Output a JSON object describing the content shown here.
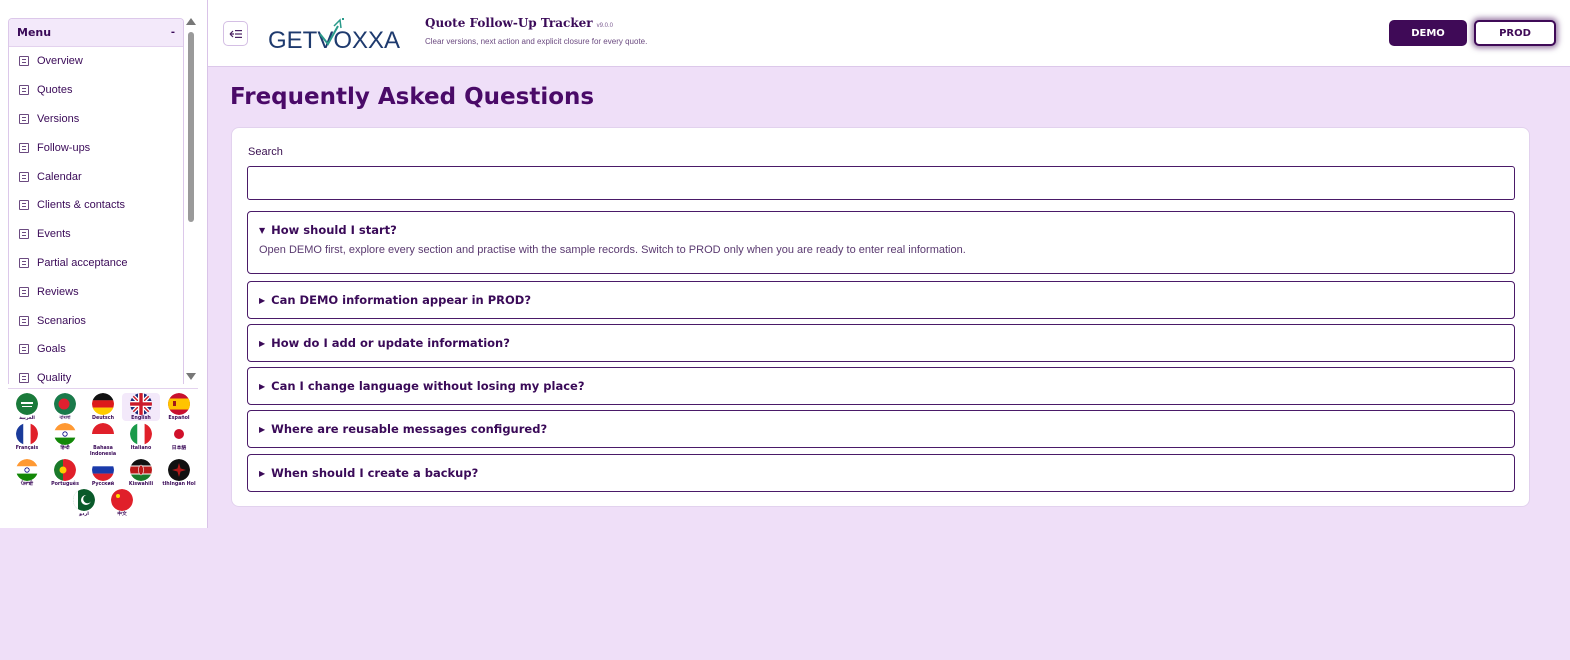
{
  "sidebar": {
    "menu_title": "Menu",
    "collapse_glyph": "-",
    "items": [
      {
        "label": "Overview"
      },
      {
        "label": "Quotes"
      },
      {
        "label": "Versions"
      },
      {
        "label": "Follow-ups"
      },
      {
        "label": "Calendar"
      },
      {
        "label": "Clients & contacts"
      },
      {
        "label": "Events"
      },
      {
        "label": "Partial acceptance"
      },
      {
        "label": "Reviews"
      },
      {
        "label": "Scenarios"
      },
      {
        "label": "Goals"
      },
      {
        "label": "Quality"
      }
    ],
    "languages": [
      {
        "label": "العربية",
        "flag": "saudi-arabia"
      },
      {
        "label": "বাংলা",
        "flag": "bangladesh"
      },
      {
        "label": "Deutsch",
        "flag": "germany"
      },
      {
        "label": "English",
        "flag": "uk",
        "active": true
      },
      {
        "label": "Español",
        "flag": "spain"
      },
      {
        "label": "Français",
        "flag": "france"
      },
      {
        "label": "हिन्दी",
        "flag": "india"
      },
      {
        "label": "Bahasa Indonesia",
        "flag": "indonesia"
      },
      {
        "label": "Italiano",
        "flag": "italy"
      },
      {
        "label": "日本語",
        "flag": "japan"
      },
      {
        "label": "ਪੰਜਾਬੀ",
        "flag": "india"
      },
      {
        "label": "Português",
        "flag": "portugal"
      },
      {
        "label": "Русский",
        "flag": "russia"
      },
      {
        "label": "Kiswahili",
        "flag": "kenya"
      },
      {
        "label": "tlhIngan Hol",
        "flag": "klingon"
      },
      {
        "label": "اردو",
        "flag": "pakistan"
      },
      {
        "label": "中文",
        "flag": "china"
      }
    ]
  },
  "header": {
    "toggle_icon": "sidebar-collapse-icon",
    "logo_text": "GETVOXXA",
    "title": "Quote Follow-Up Tracker",
    "version": "v9.0.0",
    "subtitle": "Clear versions, next action and explicit closure for every quote.",
    "demo_label": "DEMO",
    "prod_label": "PROD",
    "active_env": "PROD"
  },
  "main": {
    "page_title": "Frequently Asked Questions",
    "search_label": "Search",
    "search_value": "",
    "faqs": [
      {
        "question": "How should I start?",
        "open": true,
        "answer": "Open DEMO first, explore every section and practise with the sample records. Switch to PROD only when you are ready to enter real information."
      },
      {
        "question": "Can DEMO information appear in PROD?",
        "open": false
      },
      {
        "question": "How do I add or update information?",
        "open": false
      },
      {
        "question": "Can I change language without losing my place?",
        "open": false
      },
      {
        "question": "Where are reusable messages configured?",
        "open": false
      },
      {
        "question": "When should I create a backup?",
        "open": false
      }
    ]
  },
  "colors": {
    "accent": "#3f0a57",
    "background": "#efdff8",
    "title": "#4a0a68"
  }
}
